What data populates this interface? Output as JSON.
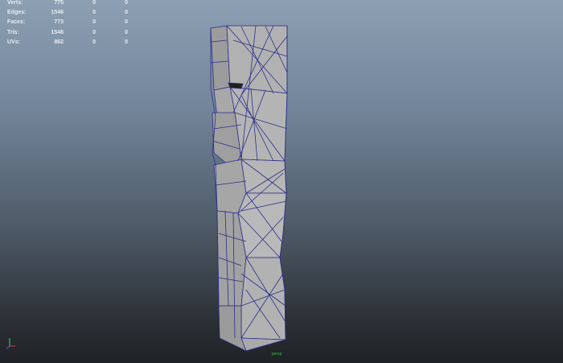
{
  "hud": {
    "rows": [
      {
        "label": "Verts:",
        "v1": "775",
        "v2": "0",
        "v3": "0"
      },
      {
        "label": "Edges:",
        "v1": "1546",
        "v2": "0",
        "v3": "0"
      },
      {
        "label": "Faces:",
        "v1": "773",
        "v2": "0",
        "v3": "0"
      },
      {
        "label": "Tris:",
        "v1": "1546",
        "v2": "0",
        "v3": "0"
      },
      {
        "label": "UVs:",
        "v1": "862",
        "v2": "0",
        "v3": "0"
      }
    ]
  },
  "camera_label": "persp",
  "colors": {
    "wireframe": "#2a2f8a",
    "mesh_face": "#a3a3a3",
    "hud_text": "#e6ecf2",
    "axis_x": "#e03b3b",
    "axis_y": "#3ddc4a",
    "axis_z": "#4a6bff"
  }
}
